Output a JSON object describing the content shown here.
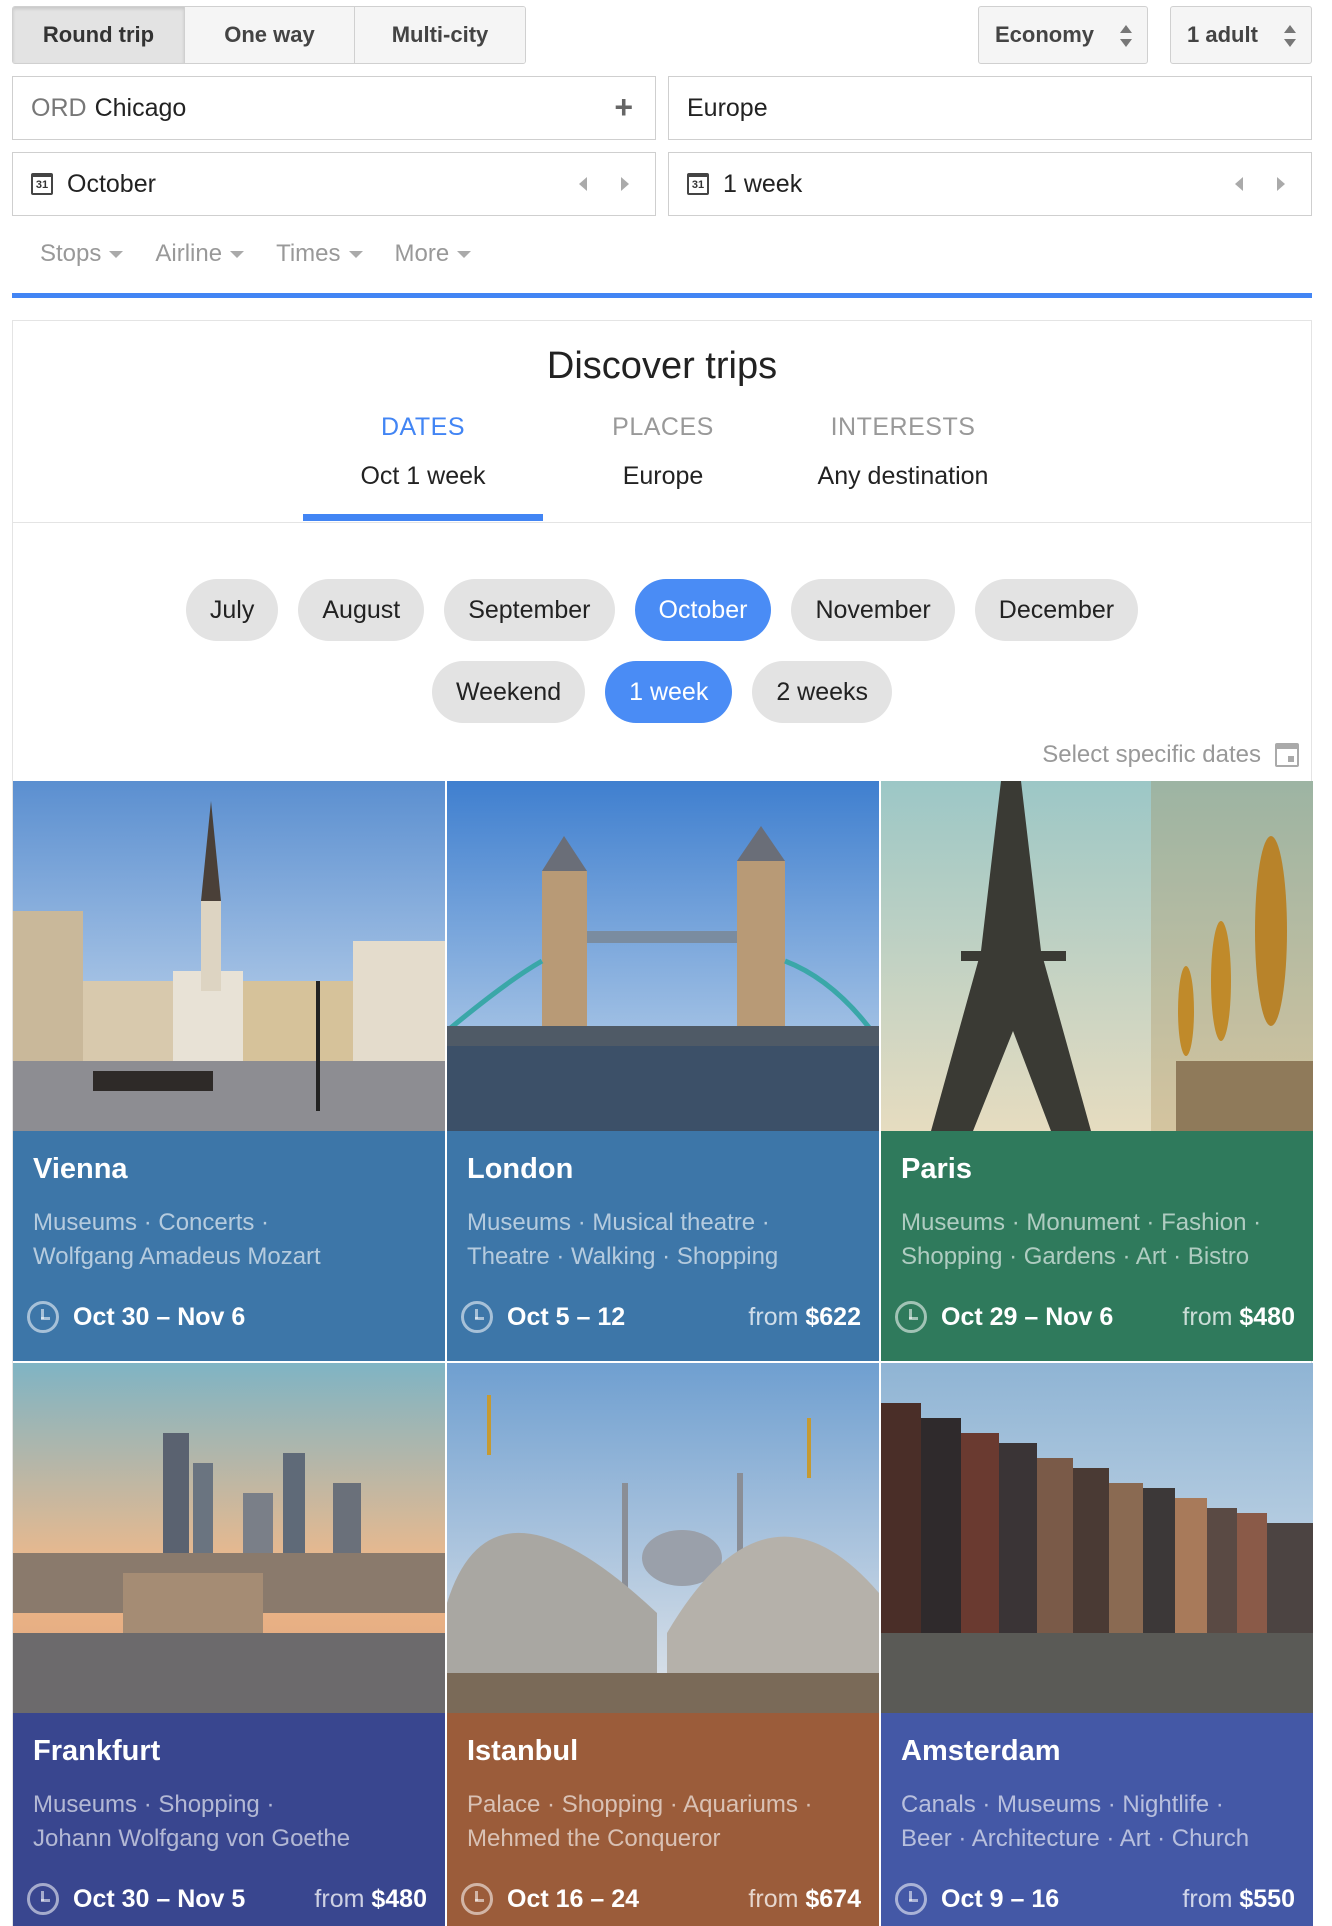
{
  "trip_type": {
    "round_trip": "Round trip",
    "one_way": "One way",
    "multi_city": "Multi-city"
  },
  "cabin_class": "Economy",
  "passengers": "1 adult",
  "origin": {
    "code": "ORD",
    "city": "Chicago"
  },
  "destination": "Europe",
  "month": {
    "icon_text": "31",
    "value": "October"
  },
  "duration": {
    "icon_text": "31",
    "value": "1 week"
  },
  "filters": [
    "Stops",
    "Airline",
    "Times",
    "More"
  ],
  "discover": {
    "title": "Discover trips",
    "tabs": [
      {
        "heading": "DATES",
        "value": "Oct 1 week"
      },
      {
        "heading": "PLACES",
        "value": "Europe"
      },
      {
        "heading": "INTERESTS",
        "value": "Any destination"
      }
    ],
    "months": [
      "July",
      "August",
      "September",
      "October",
      "November",
      "December"
    ],
    "durations": [
      "Weekend",
      "1 week",
      "2 weeks"
    ],
    "select_specific": "Select specific dates"
  },
  "colors": {
    "accent": "#4285f4",
    "card_blue": "#3d76a8",
    "card_green": "#2f7a5c",
    "card_indigo": "#39468f",
    "card_brown": "#9b5c3a",
    "card_royal": "#4458a6"
  },
  "destinations": [
    {
      "city": "Vienna",
      "tags1": "Museums · Concerts ·",
      "tags2": "Wolfgang Amadeus Mozart",
      "dates": "Oct 30 – Nov 6",
      "from": "",
      "price": ""
    },
    {
      "city": "London",
      "tags1": "Museums · Musical theatre ·",
      "tags2": "Theatre · Walking · Shopping",
      "dates": "Oct 5 – 12",
      "from": "from",
      "price": "$622"
    },
    {
      "city": "Paris",
      "tags1": "Museums · Monument · Fashion ·",
      "tags2": "Shopping · Gardens · Art · Bistro",
      "dates": "Oct 29 – Nov 6",
      "from": "from",
      "price": "$480"
    },
    {
      "city": "Frankfurt",
      "tags1": "Museums · Shopping ·",
      "tags2": "Johann Wolfgang von Goethe",
      "dates": "Oct 30 – Nov 5",
      "from": "from",
      "price": "$480"
    },
    {
      "city": "Istanbul",
      "tags1": "Palace · Shopping · Aquariums ·",
      "tags2": "Mehmed the Conqueror",
      "dates": "Oct 16 – 24",
      "from": "from",
      "price": "$674"
    },
    {
      "city": "Amsterdam",
      "tags1": "Canals · Museums · Nightlife ·",
      "tags2": "Beer · Architecture · Art · Church",
      "dates": "Oct 9 – 16",
      "from": "from",
      "price": "$550"
    }
  ]
}
